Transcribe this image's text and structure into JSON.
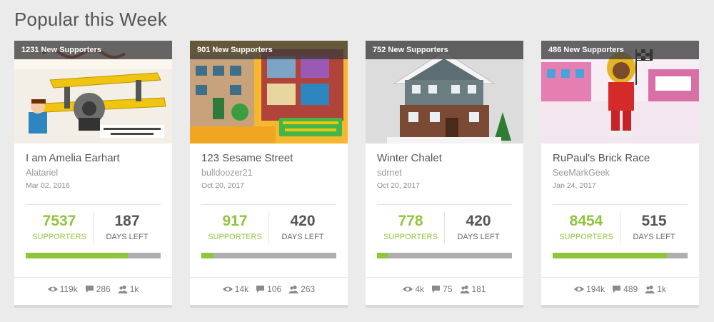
{
  "section": {
    "title": "Popular this Week"
  },
  "colors": {
    "accent": "#8fc43c",
    "track": "#aeaeae",
    "badge": "#3c3c3c"
  },
  "icons": {
    "views": "eye-icon",
    "comments": "comment-icon",
    "supporters": "supporters-icon"
  },
  "cards": [
    {
      "badge": "1231 New Supporters",
      "title": "I am Amelia Earhart",
      "author": "Alatariel",
      "date": "Mar 02, 2016",
      "supporters": "7537",
      "supporters_label": "SUPPORTERS",
      "days": "187",
      "days_label": "DAYS LEFT",
      "progress": 0.754,
      "views": "119k",
      "comments": "286",
      "followers": "1k"
    },
    {
      "badge": "901 New Supporters",
      "title": "123 Sesame Street",
      "author": "bulldoozer21",
      "date": "Oct 20, 2017",
      "supporters": "917",
      "supporters_label": "SUPPORTERS",
      "days": "420",
      "days_label": "DAYS LEFT",
      "progress": 0.092,
      "views": "14k",
      "comments": "106",
      "followers": "263"
    },
    {
      "badge": "752 New Supporters",
      "title": "Winter Chalet",
      "author": "sdrnet",
      "date": "Oct 20, 2017",
      "supporters": "778",
      "supporters_label": "SUPPORTERS",
      "days": "420",
      "days_label": "DAYS LEFT",
      "progress": 0.078,
      "views": "4k",
      "comments": "75",
      "followers": "181"
    },
    {
      "badge": "486 New Supporters",
      "title": "RuPaul's Brick Race",
      "author": "SeeMarkGeek",
      "date": "Jan 24, 2017",
      "supporters": "8454",
      "supporters_label": "SUPPORTERS",
      "days": "515",
      "days_label": "DAYS LEFT",
      "progress": 0.845,
      "views": "194k",
      "comments": "489",
      "followers": "1k"
    }
  ]
}
